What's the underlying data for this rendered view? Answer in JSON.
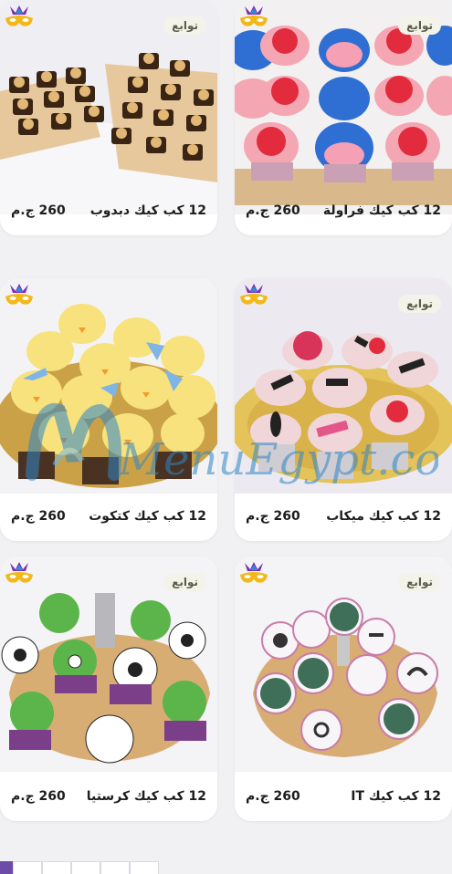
{
  "badge_label": "توابع",
  "colors": {
    "accent": "#6c4ca8",
    "card_bg": "#ffffff",
    "page_bg": "#f1f1f3",
    "badge_bg": "#f3f3ea"
  },
  "products": [
    {
      "name": "12 كب كيك فراولة",
      "price": "260 ج.م"
    },
    {
      "name": "12 كب كيك دبدوب",
      "price": "260 ج.م"
    },
    {
      "name": "12 كب كيك ميكاب",
      "price": "260 ج.م"
    },
    {
      "name": "12 كب كيك كتكوت",
      "price": "260 ج.م"
    },
    {
      "name": "12 كب كيك IT",
      "price": "260 ج.م"
    },
    {
      "name": "12 كب كيك كرستيا",
      "price": "260 ج.م"
    }
  ],
  "watermark_text": "MenuEgypt.com",
  "icons": {
    "badge_icon": "carnival-mask-icon"
  }
}
